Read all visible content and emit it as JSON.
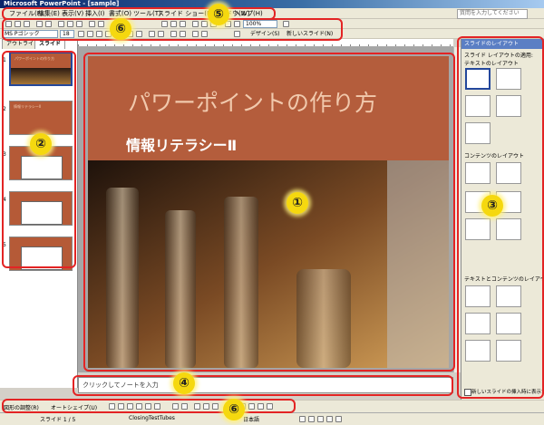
{
  "window": {
    "title": "Microsoft PowerPoint - [sample]"
  },
  "menu": {
    "items": [
      "ファイル(F)",
      "編集(E)",
      "表示(V)",
      "挿入(I)",
      "書式(O)",
      "ツール(T)",
      "スライド ショー(D)",
      "ウィンドウ(W)",
      "ヘルプ(H)"
    ],
    "help_placeholder": "質問を入力してください"
  },
  "toolbar": {
    "zoom": "100%",
    "font_name": "MS Pゴシック",
    "font_size": "18",
    "design_label": "デザイン(S)",
    "new_slide_label": "新しいスライド(N)"
  },
  "left_panel": {
    "tabs": [
      "アウトライン",
      "スライド"
    ],
    "thumb_text": [
      "パワーポイントの作り方",
      "情報リテラシーⅡ"
    ],
    "slide_numbers": [
      "1",
      "2",
      "3",
      "4",
      "5"
    ]
  },
  "slide": {
    "title": "パワーポイントの作り方",
    "subtitle": "情報リテラシーⅡ"
  },
  "notes": {
    "placeholder": "クリックしてノートを入力"
  },
  "task_pane": {
    "title": "スライドのレイアウト",
    "apply_label": "スライド レイアウトの適用:",
    "section_text": "テキストのレイアウト",
    "section_content": "コンテンツのレイアウト",
    "section_text_content": "テキストとコンテンツのレイアウト",
    "show_on_insert": "新しいスライドの挿入時に表示する"
  },
  "drawing_toolbar": {
    "draw": "図形の調整(R)",
    "autoshape": "オートシェイプ(U)"
  },
  "status": {
    "slide_position": "スライド 1 / 5",
    "design_name": "ClosingTestTubes",
    "language": "日本語"
  },
  "annotations": [
    "①",
    "②",
    "③",
    "④",
    "⑤",
    "⑥",
    "⑥"
  ],
  "colors": {
    "slide_bg": "#b45d3c",
    "annotation_red": "#e32424",
    "callout_yellow": "#f5d80f"
  }
}
